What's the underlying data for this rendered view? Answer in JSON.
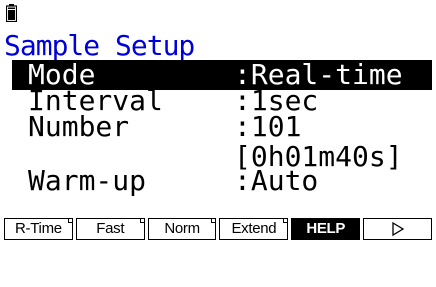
{
  "screen_title": "Sample Setup",
  "settings": [
    {
      "label": "Mode",
      "value": ":Real-time"
    },
    {
      "label": "Interval",
      "value": ":1sec"
    },
    {
      "label": "Number",
      "value": ":101"
    },
    {
      "label": "Warm-up",
      "value": ":Auto"
    }
  ],
  "number_duration": "[0h01m40s]",
  "function_keys": [
    "R-Time",
    "Fast",
    "Norm",
    "Extend",
    "HELP"
  ],
  "icons": {
    "battery": "battery-icon",
    "next": "triangle-right-icon"
  },
  "colors": {
    "title": "#0000d8",
    "selection": "#000000"
  }
}
